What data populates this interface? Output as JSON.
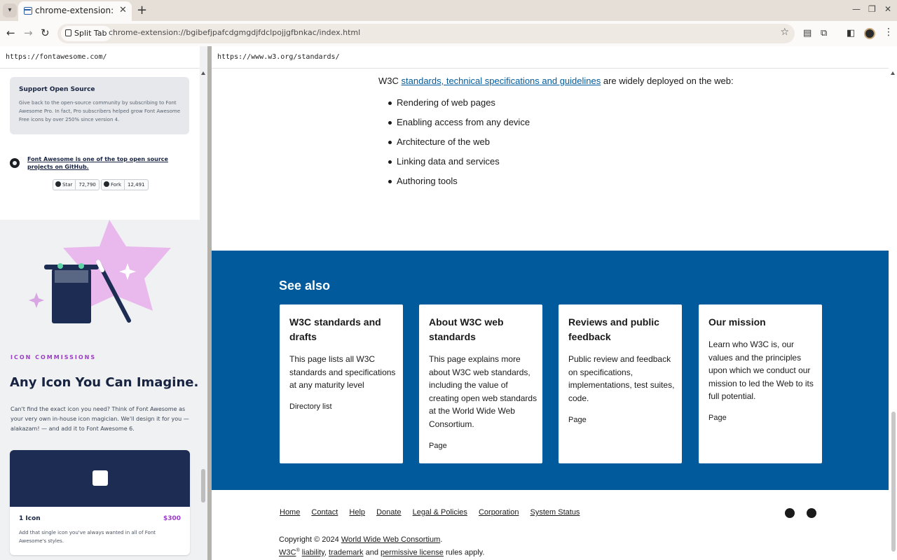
{
  "browser": {
    "tab_title": "chrome-extension://bgi",
    "tab_close": "✕",
    "new_tab": "+",
    "split_tab_label": "Split Tab",
    "url": "chrome-extension://bgibefjpafcdgmgdjfdclpojjgfbnkac/index.html"
  },
  "left_pane": {
    "url": "https://fontawesome.com/",
    "support": {
      "title": "Support Open Source",
      "text": "Give back to the open-source community by subscribing to Font Awesome Pro. In fact, Pro subscribers helped grow Font Awesome Free icons by over 250% since version 4."
    },
    "github": {
      "text": "Font Awesome is one of the top open source projects on GitHub.",
      "star_label": "Star",
      "star_count": "72,790",
      "fork_label": "Fork",
      "fork_count": "12,491"
    },
    "commissions": {
      "kicker": "ICON COMMISSIONS",
      "heading": "Any Icon You Can Imagine.",
      "body": "Can't find the exact icon you need? Think of Font Awesome as your very own in-house icon magician. We'll design it for you — alakazam! — and add it to Font Awesome 6.",
      "card_name": "1 Icon",
      "card_price": "$300",
      "card_desc": "Add that single icon you've always wanted in all of Font Awesome's styles."
    }
  },
  "right_pane": {
    "url": "https://www.w3.org/standards/",
    "intro_prefix": "W3C",
    "intro_link": "standards, technical specifications and guidelines",
    "intro_suffix": "are widely deployed on the web:",
    "list": [
      "Rendering of web pages",
      "Enabling access from any device",
      "Architecture of the web",
      "Linking data and services",
      "Authoring tools"
    ],
    "see_also_title": "See also",
    "cards": [
      {
        "title": "W3C standards and drafts",
        "desc": "This page lists all W3C standards and specifications at any maturity level",
        "link": "Directory list"
      },
      {
        "title": "About W3C web standards",
        "desc": "This page explains more about W3C web standards, including the value of creating open web standards at the World Wide Web Consortium.",
        "link": "Page"
      },
      {
        "title": "Reviews and public feedback",
        "desc": "Public review and feedback on specifications, implementations, test suites, code.",
        "link": "Page"
      },
      {
        "title": "Our mission",
        "desc": "Learn who W3C is, our values and the principles upon which we conduct our mission to led the Web to its full potential.",
        "link": "Page"
      }
    ],
    "footer": {
      "nav": [
        "Home",
        "Contact",
        "Help",
        "Donate",
        "Legal & Policies",
        "Corporation",
        "System Status"
      ],
      "copyright_prefix": "Copyright © 2024",
      "copyright_org": "World Wide Web Consortium",
      "copyright_suffix": ".",
      "w3c": "W3C",
      "reg": "®",
      "liability": "liability",
      "trademark": "trademark",
      "and": "and",
      "license": "permissive license",
      "rules": "rules apply."
    }
  },
  "colors": {
    "w3c_blue": "#005a9c",
    "fa_navy": "#172340",
    "fa_purple": "#9d3bc9"
  }
}
